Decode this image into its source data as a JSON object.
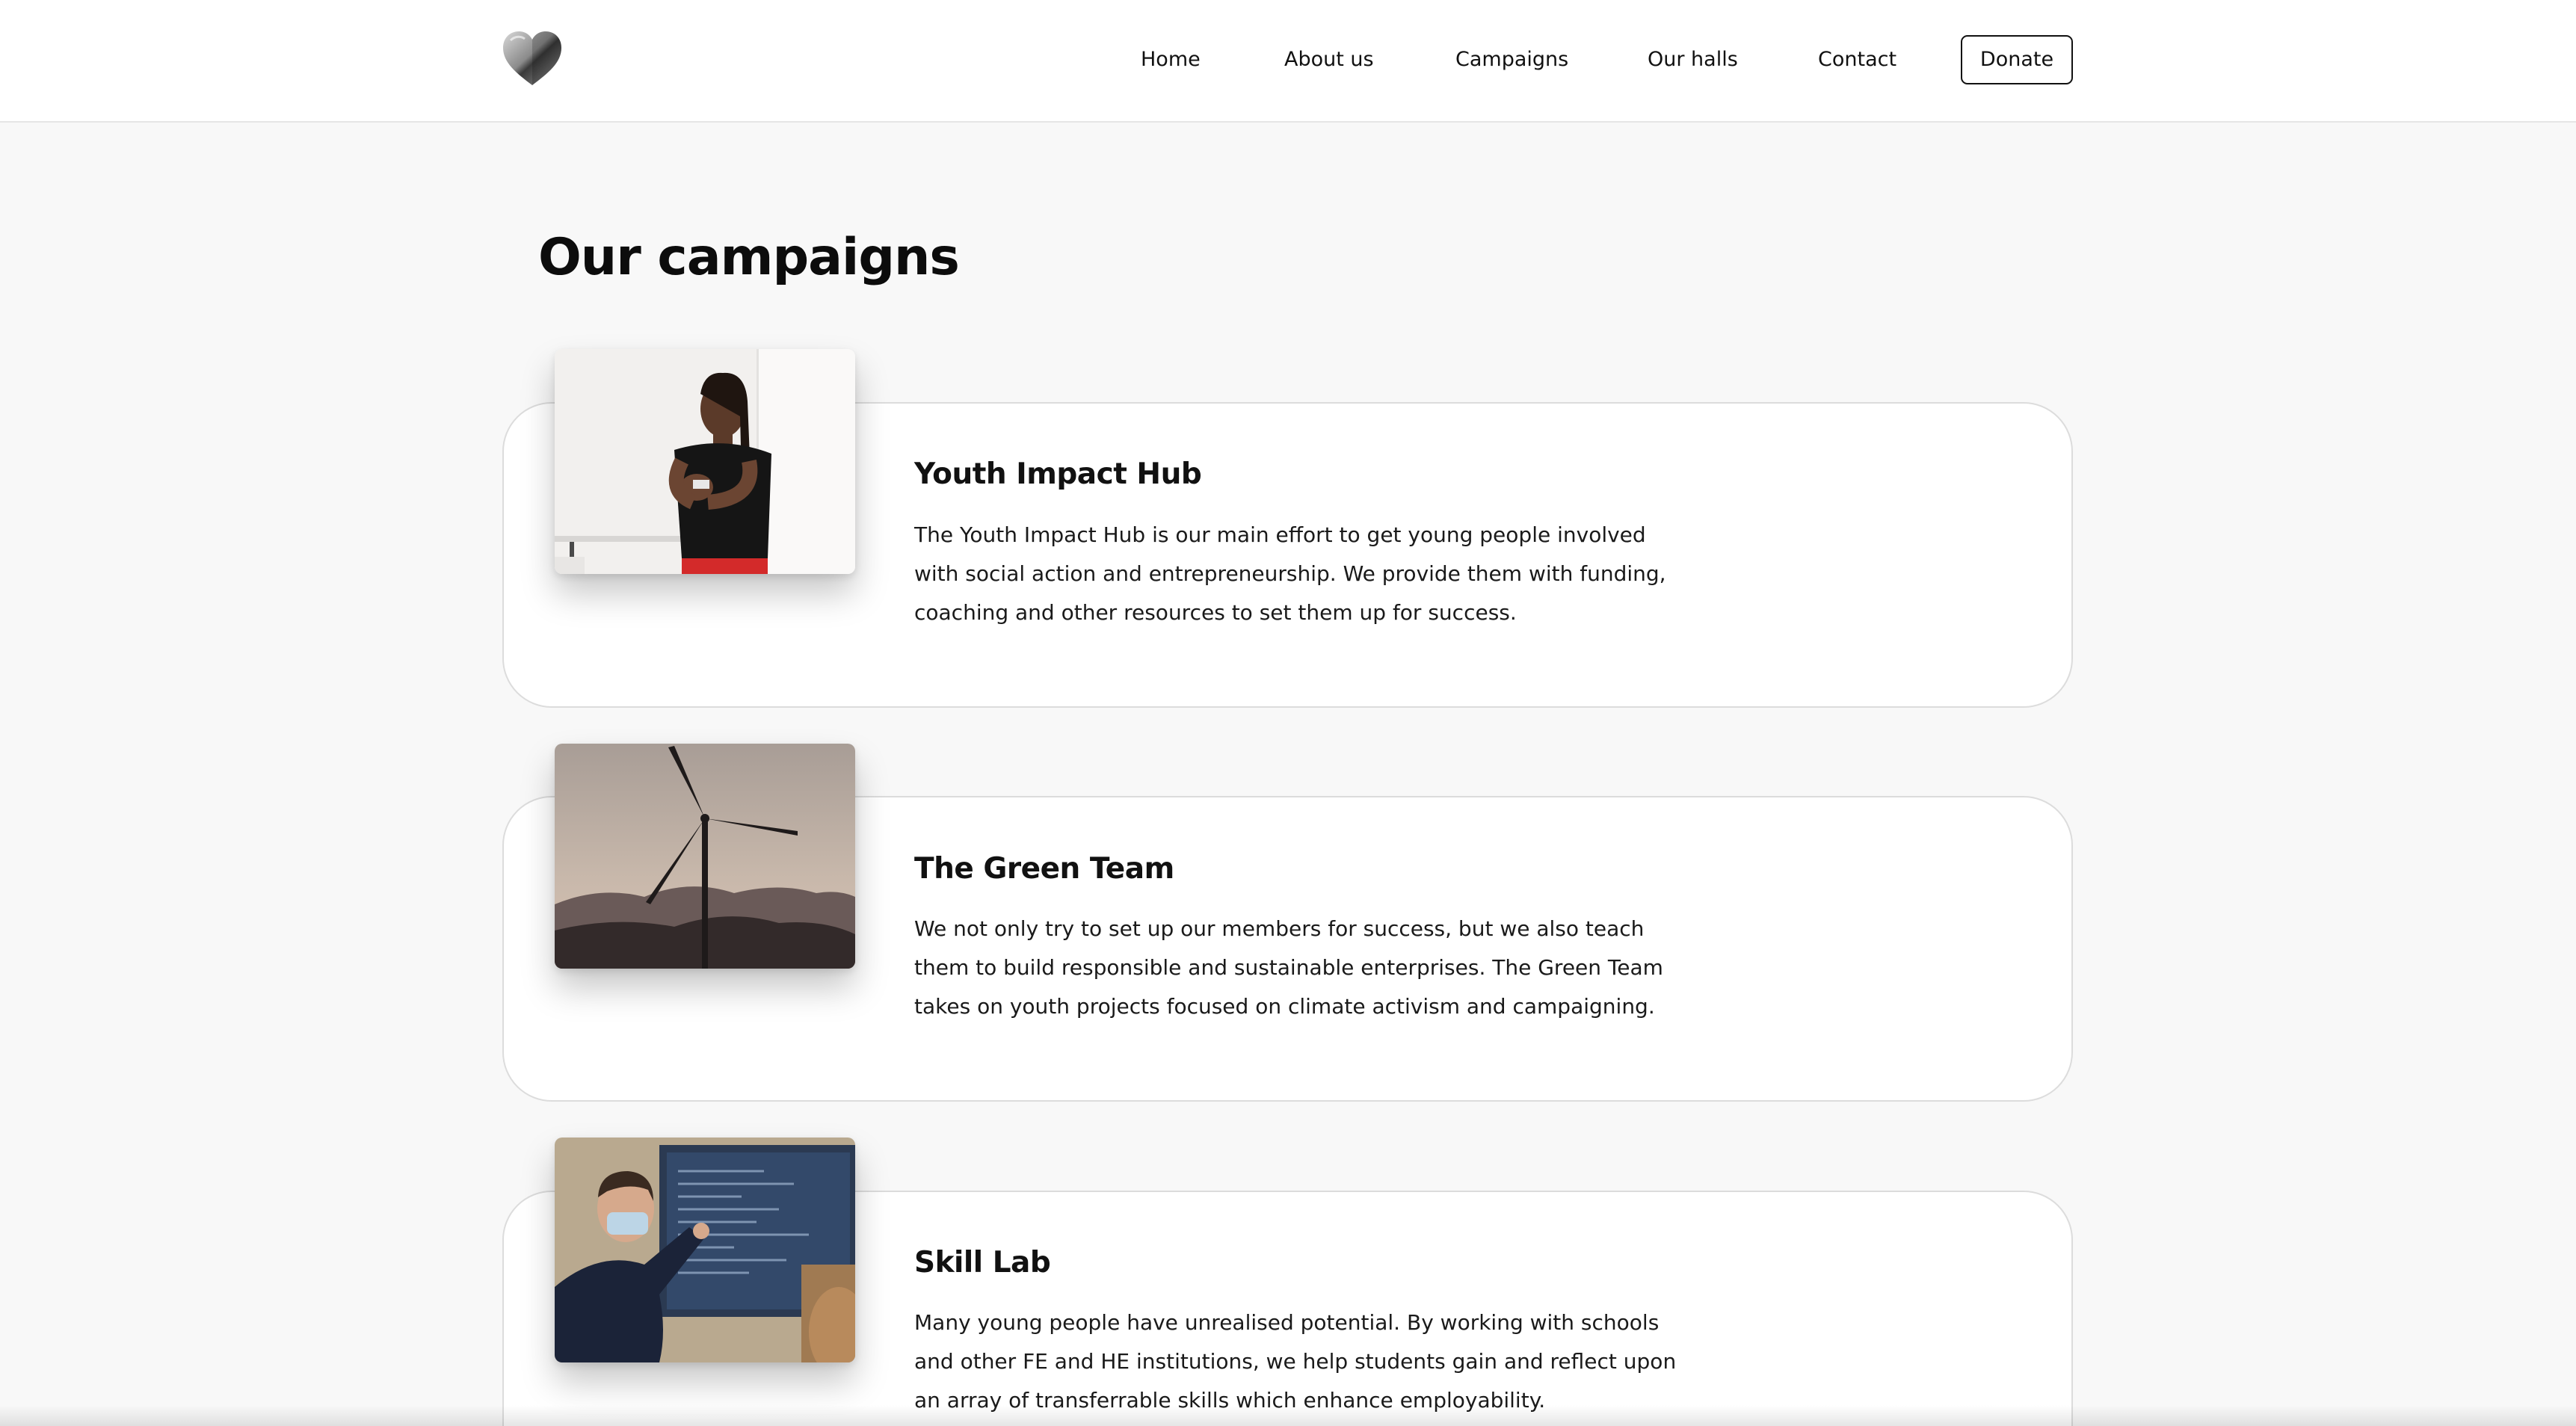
{
  "nav": {
    "logo_icon": "heart-icon",
    "links": [
      "Home",
      "About us",
      "Campaigns",
      "Our halls",
      "Contact"
    ],
    "donate_label": "Donate"
  },
  "page": {
    "title": "Our campaigns"
  },
  "campaigns": [
    {
      "title": "Youth Impact Hub",
      "description": "The Youth Impact Hub is our main effort to get young people involved with social action and entrepreneurship. We provide them with funding, coaching and other resources to set them up for success.",
      "image": "speaker-photo"
    },
    {
      "title": "The Green Team",
      "description": "We not only try to set up our members for success, but we also teach them to build responsible and sustainable enterprises. The Green Team takes on youth projects focused on climate activism and campaigning.",
      "image": "wind-turbine-photo"
    },
    {
      "title": "Skill Lab",
      "description": "Many young people have unrealised potential. By working with schools and other FE and HE institutions, we help students gain and reflect upon an array of transferrable skills which enhance employability.",
      "image": "presenter-photo"
    }
  ]
}
